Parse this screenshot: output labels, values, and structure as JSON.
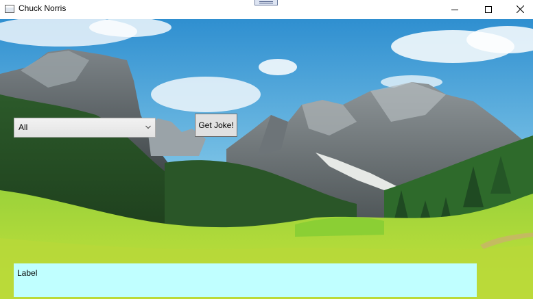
{
  "window": {
    "title": "Chuck Norris",
    "icons": {
      "app": "window-app-icon",
      "minimize": "minimize-icon",
      "maximize": "maximize-icon",
      "close": "close-icon"
    }
  },
  "controls": {
    "category_select": {
      "selected": "All",
      "icon": "chevron-down-icon"
    },
    "get_joke_label": "Get Joke!",
    "output_label": "Label"
  },
  "colors": {
    "label_background": "#c0ffff",
    "button_face": "#e1e1e1",
    "combo_face": "#e7e7e7"
  }
}
